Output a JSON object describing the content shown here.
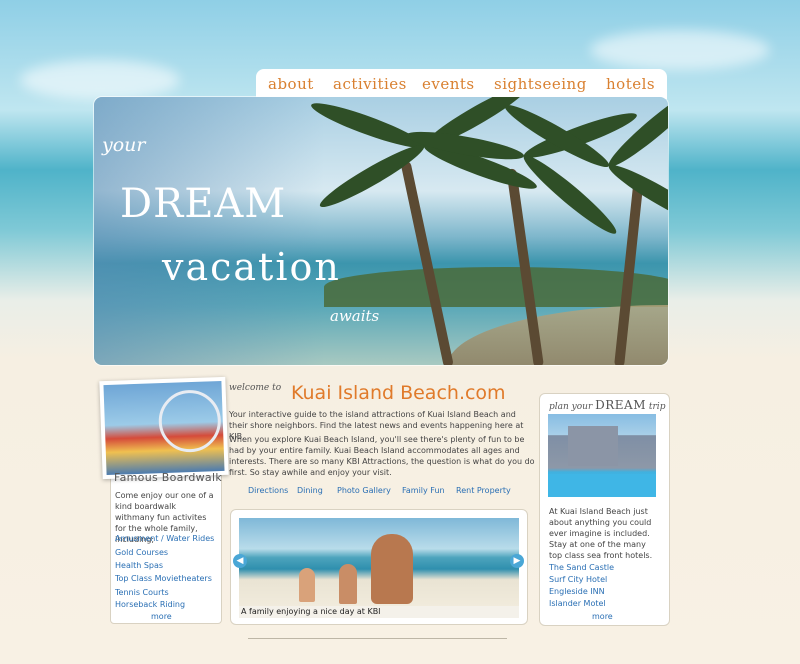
{
  "nav": {
    "items": [
      "about",
      "activities",
      "events",
      "sightseeing",
      "hotels"
    ]
  },
  "hero": {
    "your": "your",
    "dream": "DREAM",
    "vacation": "vacation",
    "awaits": "awaits"
  },
  "welcome": {
    "prefix": "welcome to",
    "site_name": "Kuai Island Beach.com",
    "para1": "Your interactive guide to the island attractions of Kuai Island Beach and their shore neighbors. Find the latest news and events happening here at KIB.",
    "para2": "When you explore Kuai Beach Island, you'll see there's plenty of fun to be had by your entire family. Kuai Beach Island accommodates all ages and interests. There are so many KBI Attractions, the question is what do you do first. So stay awhile and enjoy your visit."
  },
  "center_links": [
    "Directions",
    "Dining",
    "Photo Gallery",
    "Family Fun",
    "Rent Property"
  ],
  "slider": {
    "caption": "A family enjoying a nice day at KBI",
    "prev_icon": "arrow-left-icon",
    "next_icon": "arrow-right-icon"
  },
  "boardwalk": {
    "title": "Famous Boardwalk",
    "description": "Come enjoy our one of a kind boardwalk withmany fun activites for the whole family, including;",
    "links": [
      "Amusment / Water Rides",
      "Gold Courses",
      "Health Spas",
      "Top Class Movietheaters",
      "Tennis Courts",
      "Horseback Riding"
    ],
    "more": "more"
  },
  "plan": {
    "prefix": "plan your",
    "dream": "DREAM",
    "suffix": "trip",
    "description": "At Kuai Island Beach just about anything you could ever imagine is included. Stay at one of the many top class sea front hotels.",
    "links": [
      "The Sand Castle",
      "Surf City Hotel",
      "Engleside INN",
      "Islander Motel"
    ],
    "more": "more"
  },
  "colors": {
    "nav_accent": "#d98030",
    "link": "#2a6fb4",
    "title_orange": "#e07a2a"
  }
}
